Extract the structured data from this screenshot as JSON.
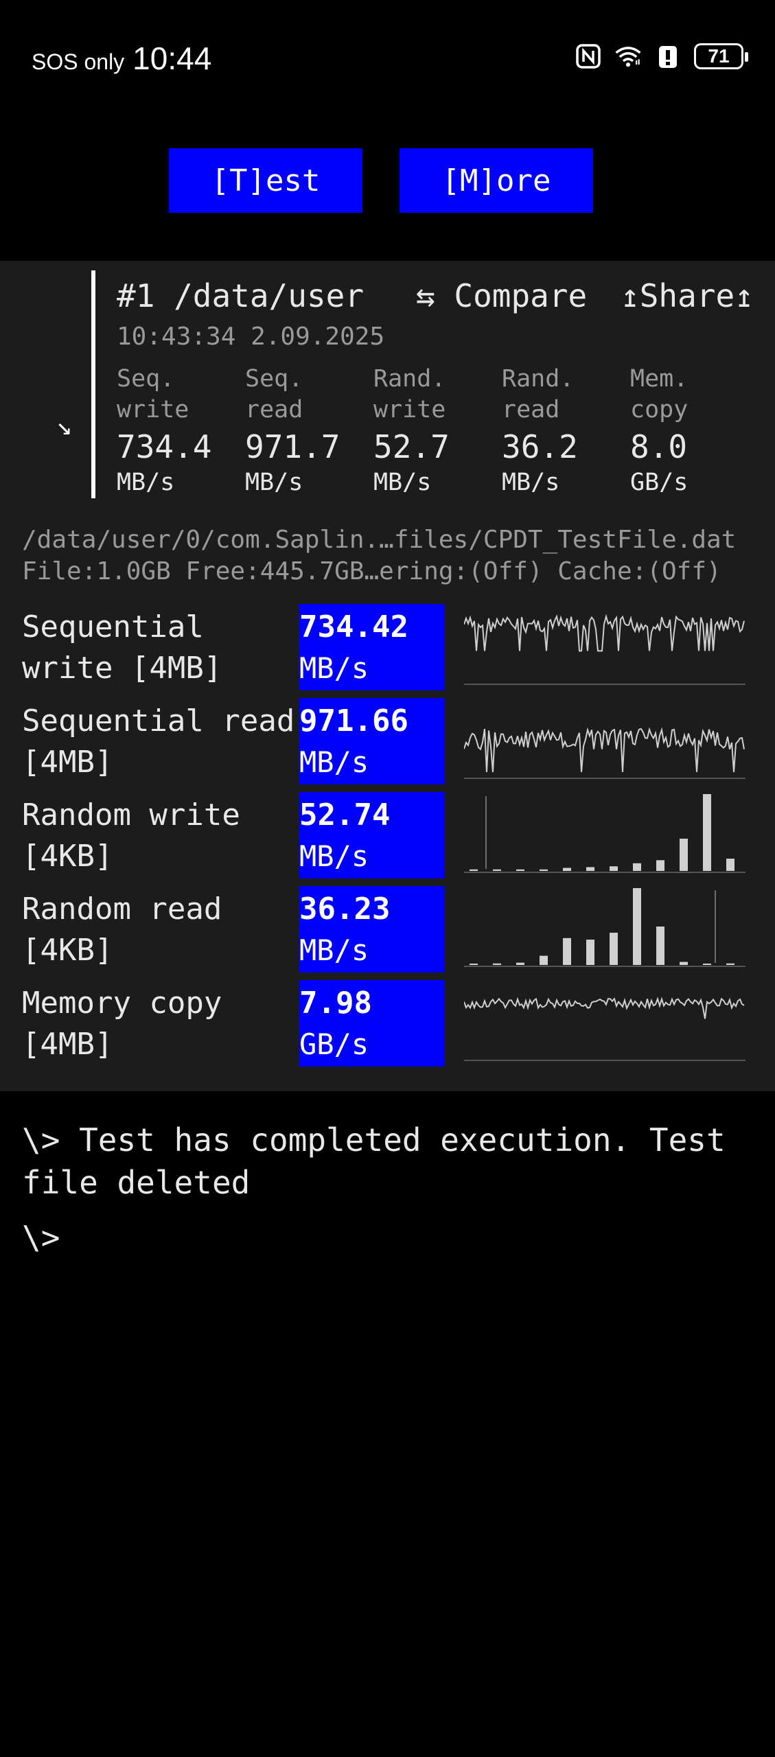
{
  "status_bar": {
    "carrier": "SOS only",
    "time": "10:44",
    "icons": [
      "nfc-icon",
      "wifi-icon",
      "battery-alert-icon"
    ],
    "battery_level": "71"
  },
  "toolbar": {
    "test_label": "[T]est",
    "more_label": "[M]ore"
  },
  "run": {
    "title": "#1 /data/user",
    "compare_label": "⇆ Compare",
    "share_label": "↥Share↥",
    "timestamp": "10:43:34 2.09.2025",
    "collapse_glyph": "↘",
    "metrics": [
      {
        "label": "Seq.\nwrite",
        "value": "734.4",
        "unit": "MB/s"
      },
      {
        "label": "Seq.\nread",
        "value": "971.7",
        "unit": "MB/s"
      },
      {
        "label": "Rand.\nwrite",
        "value": "52.7",
        "unit": "MB/s"
      },
      {
        "label": "Rand.\nread",
        "value": "36.2",
        "unit": "MB/s"
      },
      {
        "label": "Mem.\ncopy",
        "value": "8.0",
        "unit": "GB/s"
      }
    ]
  },
  "file_info": {
    "path": "/data/user/0/com.Saplin.…files/CPDT_TestFile.dat",
    "details": "File:1.0GB Free:445.7GB…ering:(Off) Cache:(Off)"
  },
  "results": [
    {
      "label": "Sequential write [4MB]",
      "value": "734.42",
      "unit": "MB/s",
      "graph": "line"
    },
    {
      "label": "Sequential read [4MB]",
      "value": "971.66",
      "unit": "MB/s",
      "graph": "line"
    },
    {
      "label": "Random write [4KB]",
      "value": "52.74",
      "unit": "MB/s",
      "graph": "histogram"
    },
    {
      "label": "Random read [4KB]",
      "value": "36.23",
      "unit": "MB/s",
      "graph": "histogram"
    },
    {
      "label": "Memory copy [4MB]",
      "value": "7.98",
      "unit": "GB/s",
      "graph": "line"
    }
  ],
  "histograms": {
    "random_write": [
      0.02,
      0.02,
      0.02,
      0.02,
      0.04,
      0.05,
      0.06,
      0.1,
      0.14,
      0.42,
      1.0,
      0.16
    ],
    "random_read": [
      0.0,
      0.02,
      0.03,
      0.12,
      0.35,
      0.33,
      0.42,
      1.0,
      0.5,
      0.04,
      0.0,
      0.02
    ]
  },
  "terminal": {
    "message": "\\> Test has completed execution. Test file deleted",
    "prompt": "\\>"
  },
  "colors": {
    "accent": "#0000ff",
    "panel_bg": "#1c1c1c",
    "text": "#e8e8e8",
    "muted": "#9a9a9a"
  }
}
